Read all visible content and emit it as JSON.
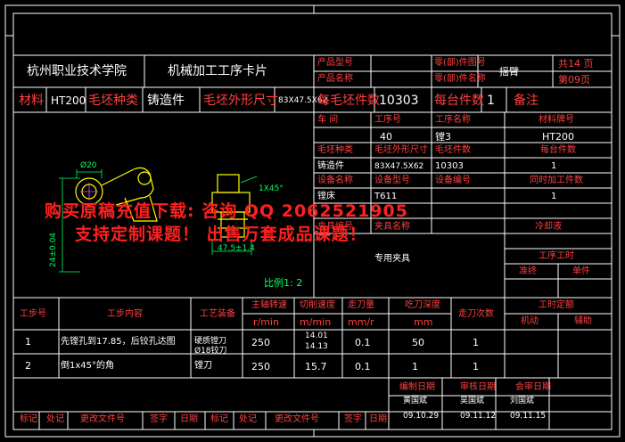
{
  "header": {
    "school": "杭州职业技术学院",
    "card_title": "机械加工工序卡片",
    "product_model_label": "产品型号",
    "product_name_label": "产品名称",
    "part_no_label": "零(部)件图号",
    "part_name_label": "零(部)件名称",
    "part_name_value": "摇臂",
    "total_pages": "共14 页",
    "page_no": "第09页"
  },
  "row2": {
    "material_label": "材料",
    "material_value": "HT200",
    "blank_type_label": "毛坯种类",
    "blank_type_value": "铸造件",
    "blank_size_label": "毛坯外形尺寸",
    "blank_size_value": "83X47.5X62",
    "blanks_per_label": "每毛坯件数",
    "blanks_per_value": "10303",
    "per_unit_label": "每台件数",
    "per_unit_value": "1",
    "remarks_label": "备注"
  },
  "info_table": {
    "r1_labels": [
      "车 间",
      "工序号",
      "工序名称",
      "材料牌号"
    ],
    "r1_values": [
      "",
      "40",
      "镗3",
      "HT200"
    ],
    "r2_labels": [
      "毛坯种类",
      "毛坯外形尺寸",
      "毛坯件数",
      "每台件数"
    ],
    "r2_values": [
      "铸造件",
      "83X47.5X62",
      "10303",
      "1"
    ],
    "r3_labels": [
      "设备名称",
      "设备型号",
      "设备编号",
      "同时加工件数"
    ],
    "r3_values": [
      "镗床",
      "T611",
      "",
      "1"
    ],
    "fixture_labels": [
      "夹具编号",
      "夹具名称",
      "冷却液"
    ],
    "fixture_value": "专用夹具",
    "time_label": "工序工时",
    "prep_label": "准终",
    "unit_label": "单件"
  },
  "drawing": {
    "dim_diameter": "Ø20",
    "dim_chamfer": "1X45°",
    "dim_length": "47.5±1.4",
    "dim_vertical": "24±0.04",
    "scale_label": "比例1: 2"
  },
  "steps": {
    "headers": {
      "no": "工步号",
      "content": "工步内容",
      "equipment": "工艺装备",
      "spindle_speed": "主轴转速",
      "spindle_unit": "r/min",
      "cutting_speed": "切削速度",
      "cutting_unit": "m/min",
      "feed": "走刀量",
      "feed_unit": "mm/r",
      "depth": "吃刀深度",
      "depth_unit": "mm",
      "passes": "走刀次数",
      "time_quota": "工时定额",
      "machine_time": "机动",
      "aux_time": "辅助"
    },
    "rows": [
      {
        "no": "1",
        "content": "先镗孔到17.85，后铰孔达图",
        "equipment": "硬质镗刀 Ø18铰刀",
        "speed": "250",
        "cut_a": "14.01",
        "cut_b": "14.13",
        "feed": "0.1",
        "depth": "50",
        "passes": "1"
      },
      {
        "no": "2",
        "content": "倒1x45°的角",
        "equipment": "镗刀",
        "speed": "250",
        "cut_a": "15.7",
        "cut_b": "",
        "feed": "0.1",
        "depth": "1",
        "passes": "1"
      }
    ]
  },
  "signoff": {
    "compile_label": "编制日期",
    "review_label": "审核日期",
    "sign_label": "会审日期",
    "compile_value": "黄国斌",
    "compile_date": "09.10.29",
    "review_value": "吴国斌",
    "review_date": "09.11.12",
    "sign_value": "刘国斌",
    "sign_date": "09.11.15",
    "footer": [
      "标记",
      "处记",
      "更改文件号",
      "签字",
      "日期",
      "标记",
      "处记",
      "更改文件号",
      "签字",
      "日期"
    ]
  },
  "watermark": {
    "line1": "购买原稿充值下载: 咨询 QQ 2062521905",
    "line2": "支持定制课题！  出售万套成品课题！"
  },
  "colors": {
    "background": "#000000",
    "grid": "#ffffff",
    "label": "#ff4040",
    "value": "#ffffff",
    "drawing": "#ffff00",
    "dimension": "#00ff66",
    "watermark": "#ff2020"
  }
}
